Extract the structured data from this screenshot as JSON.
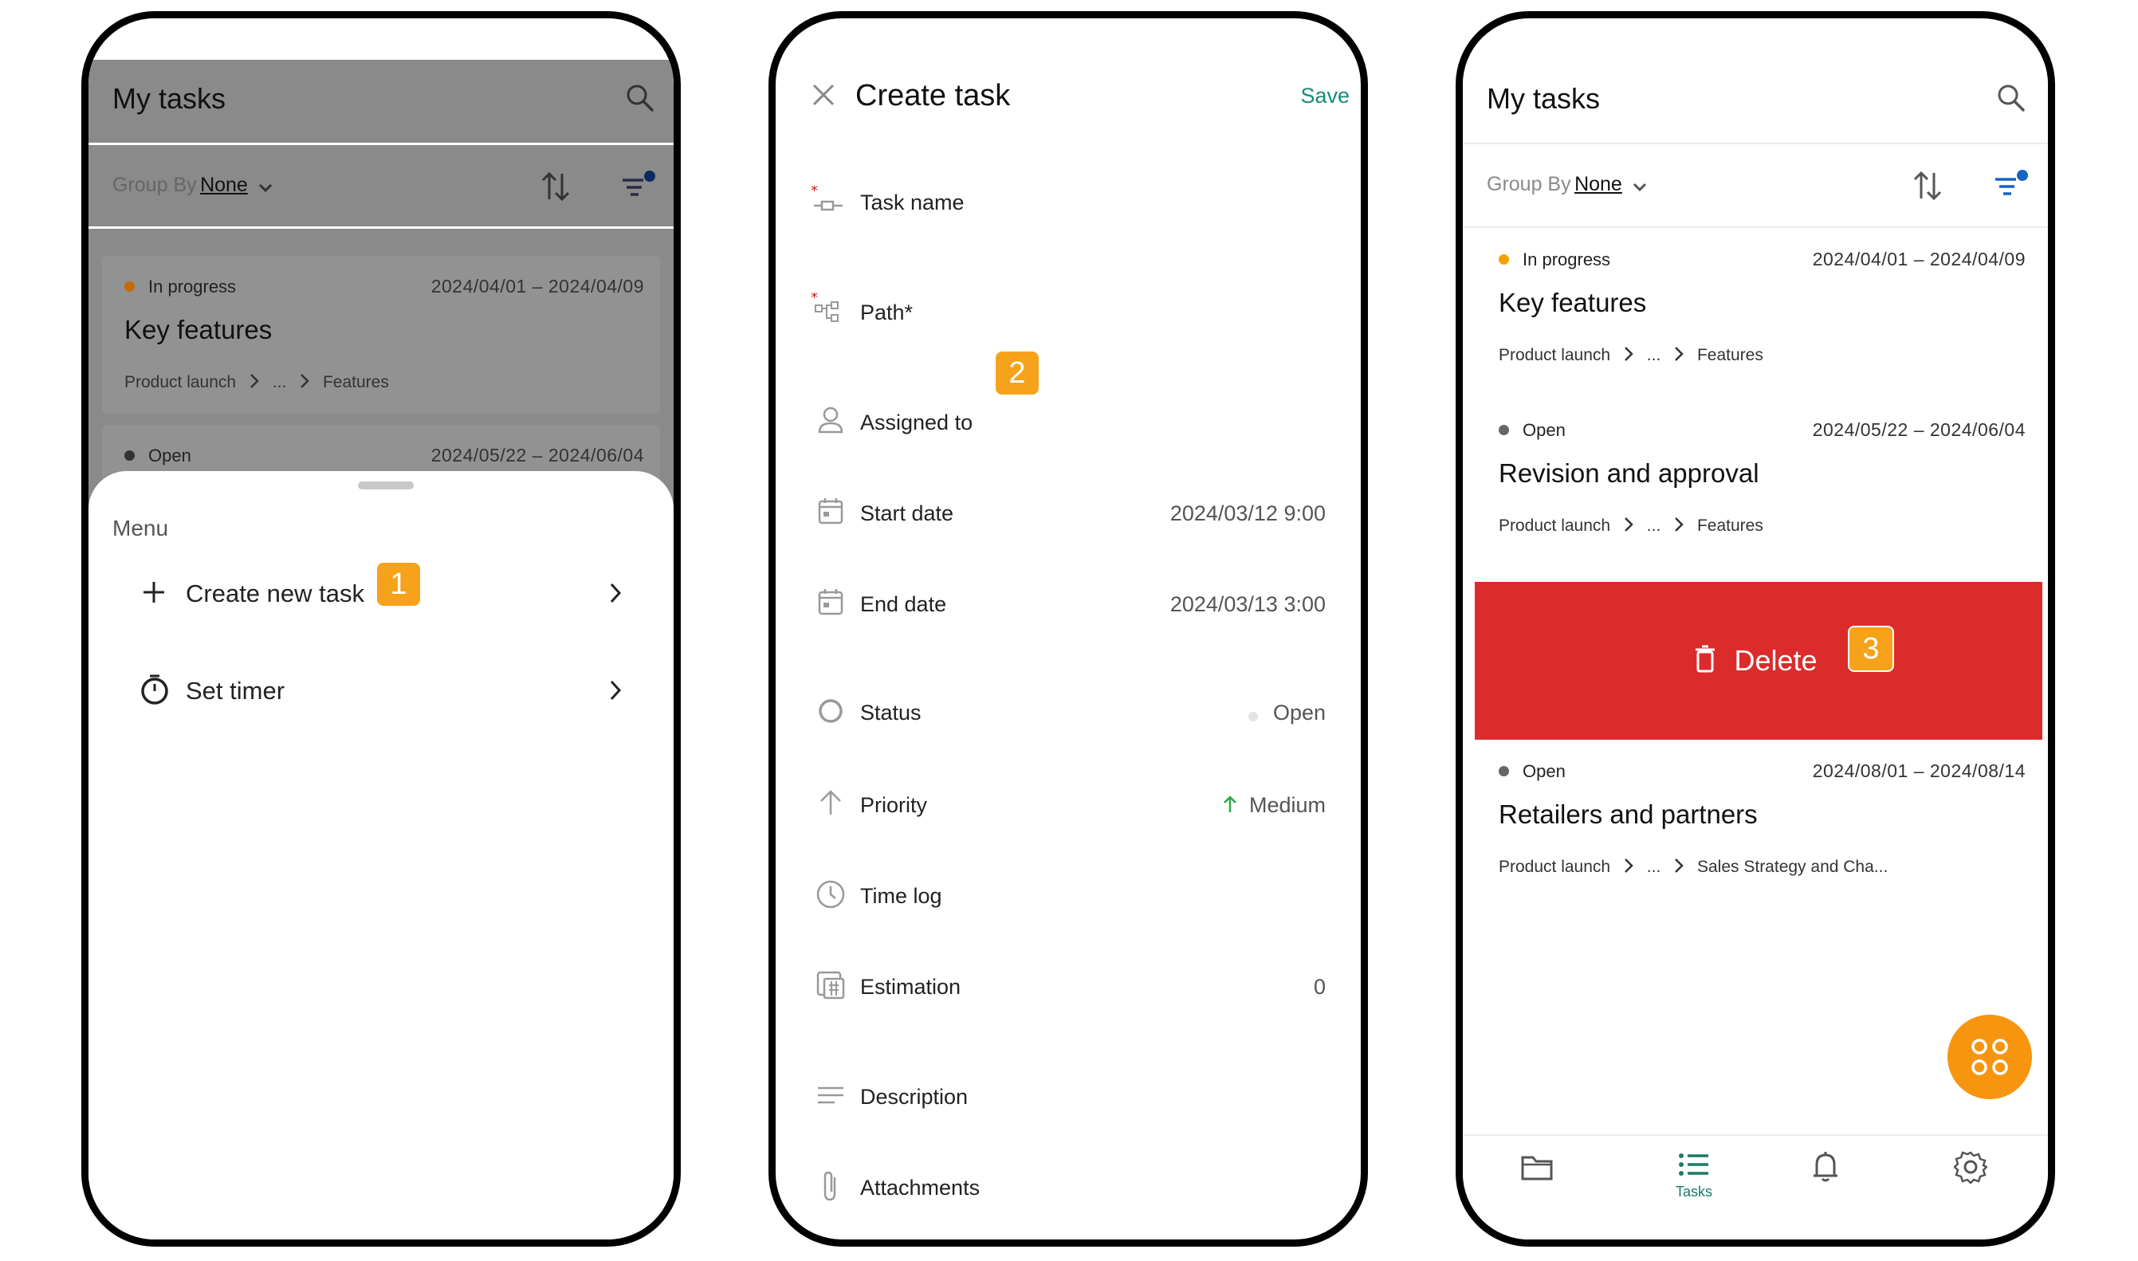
{
  "phone1": {
    "header": {
      "title": "My tasks"
    },
    "group_by": {
      "label": "Group By",
      "value": "None"
    },
    "tasks": [
      {
        "status": "In progress",
        "status_color": "#c56a00",
        "dates": "2024/04/01 – 2024/04/09",
        "title": "Key features",
        "crumbs": [
          "Product launch",
          "...",
          "Features"
        ]
      },
      {
        "status": "Open",
        "status_color": "#333333",
        "dates": "2024/05/22 – 2024/06/04"
      }
    ],
    "menu": {
      "label": "Menu",
      "items": [
        {
          "label": "Create new task"
        },
        {
          "label": "Set timer"
        }
      ]
    },
    "badge": "1"
  },
  "phone2": {
    "header": {
      "title": "Create task",
      "save": "Save"
    },
    "fields": [
      {
        "label": "Task name",
        "value": ""
      },
      {
        "label": "Path*",
        "value": ""
      },
      {
        "label": "Assigned to",
        "value": ""
      },
      {
        "label": "Start date",
        "value": "2024/03/12 9:00"
      },
      {
        "label": "End date",
        "value": "2024/03/13 3:00"
      },
      {
        "label": "Status",
        "value": "Open"
      },
      {
        "label": "Priority",
        "value": "Medium"
      },
      {
        "label": "Time log",
        "value": ""
      },
      {
        "label": "Estimation",
        "value": "0"
      },
      {
        "label": "Description",
        "value": ""
      },
      {
        "label": "Attachments",
        "value": ""
      }
    ],
    "badge": "2"
  },
  "phone3": {
    "header": {
      "title": "My tasks"
    },
    "group_by": {
      "label": "Group By",
      "value": "None"
    },
    "tasks": [
      {
        "status": "In progress",
        "status_color": "#f5a000",
        "dates": "2024/04/01 – 2024/04/09",
        "title": "Key features",
        "crumbs": [
          "Product launch",
          "...",
          "Features"
        ]
      },
      {
        "status": "Open",
        "status_color": "#666666",
        "dates": "2024/05/22 – 2024/06/04",
        "title": "Revision and approval",
        "crumbs": [
          "Product launch",
          "...",
          "Features"
        ]
      },
      {
        "status": "Open",
        "status_color": "#666666",
        "dates": "2024/08/01 – 2024/08/14",
        "title": "Retailers and partners",
        "crumbs": [
          "Product launch",
          "...",
          "Sales Strategy and Cha..."
        ]
      }
    ],
    "delete_label": "Delete",
    "badge": "3",
    "nav": {
      "tasks_label": "Tasks"
    },
    "colors": {
      "delete": "#dc2b2b",
      "fab": "#f7950f",
      "accent": "#1a7a6a",
      "filter_dot": "#1565c0"
    }
  }
}
